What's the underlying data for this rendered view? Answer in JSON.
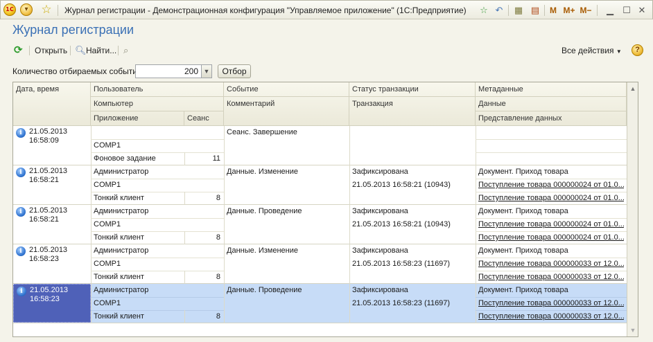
{
  "window": {
    "title": "Журнал регистрации - Демонстрационная конфигурация \"Управляемое приложение\"  (1С:Предприятие)",
    "logo_text": "1С",
    "m_label": "M",
    "mplus_label": "M+",
    "mminus_label": "M−"
  },
  "page": {
    "title": "Журнал регистрации"
  },
  "commandbar": {
    "open_label": "Открыть",
    "find_label": "Найти...",
    "all_actions_label": "Все действия",
    "help_label": "?"
  },
  "filter": {
    "label": "Количество отбираемых событий:",
    "value": "200",
    "button_label": "Отбор"
  },
  "grid": {
    "headers": {
      "date": "Дата, время",
      "user": "Пользователь",
      "computer": "Компьютер",
      "application": "Приложение",
      "session": "Сеанс",
      "event": "Событие",
      "comment": "Комментарий",
      "tx_status": "Статус транзакции",
      "transaction": "Транзакция",
      "metadata": "Метаданные",
      "data": "Данные",
      "data_repr": "Представление данных"
    },
    "rows": [
      {
        "date": "21.05.2013",
        "time": "16:58:09",
        "user": "",
        "computer": "COMP1",
        "application": "Фоновое задание",
        "session": "11",
        "event": "Сеанс. Завершение",
        "comment": "",
        "tx_status": "",
        "transaction": "",
        "metadata": "",
        "data": "",
        "data_repr": ""
      },
      {
        "date": "21.05.2013",
        "time": "16:58:21",
        "user": "Администратор",
        "computer": "COMP1",
        "application": "Тонкий клиент",
        "session": "8",
        "event": "Данные. Изменение",
        "comment": "",
        "tx_status": "Зафиксирована",
        "transaction": "21.05.2013 16:58:21 (10943)",
        "metadata": "Документ. Приход товара",
        "data": "Поступление товара 000000024 от 01.0...",
        "data_repr": "Поступление товара 000000024 от 01.0..."
      },
      {
        "date": "21.05.2013",
        "time": "16:58:21",
        "user": "Администратор",
        "computer": "COMP1",
        "application": "Тонкий клиент",
        "session": "8",
        "event": "Данные. Проведение",
        "comment": "",
        "tx_status": "Зафиксирована",
        "transaction": "21.05.2013 16:58:21 (10943)",
        "metadata": "Документ. Приход товара",
        "data": "Поступление товара 000000024 от 01.0...",
        "data_repr": "Поступление товара 000000024 от 01.0..."
      },
      {
        "date": "21.05.2013",
        "time": "16:58:23",
        "user": "Администратор",
        "computer": "COMP1",
        "application": "Тонкий клиент",
        "session": "8",
        "event": "Данные. Изменение",
        "comment": "",
        "tx_status": "Зафиксирована",
        "transaction": "21.05.2013 16:58:23 (11697)",
        "metadata": "Документ. Приход товара",
        "data": "Поступление товара 000000033 от 12.0...",
        "data_repr": "Поступление товара 000000033 от 12.0..."
      },
      {
        "date": "21.05.2013",
        "time": "16:58:23",
        "user": "Администратор",
        "computer": "COMP1",
        "application": "Тонкий клиент",
        "session": "8",
        "event": "Данные. Проведение",
        "comment": "",
        "tx_status": "Зафиксирована",
        "transaction": "21.05.2013 16:58:23 (11697)",
        "metadata": "Документ. Приход товара",
        "data": "Поступление товара 000000033 от 12.0...",
        "data_repr": "Поступление товара 000000033 от 12.0...",
        "selected": true
      }
    ]
  },
  "icons": {
    "refresh": "refresh-icon",
    "find": "magnifier-icon",
    "clear_search": "clear-search-icon",
    "info": "info-icon"
  },
  "colors": {
    "title_blue": "#3a70b5",
    "selected_row": "#c7dcf7",
    "selected_cell": "#4f61b8"
  }
}
